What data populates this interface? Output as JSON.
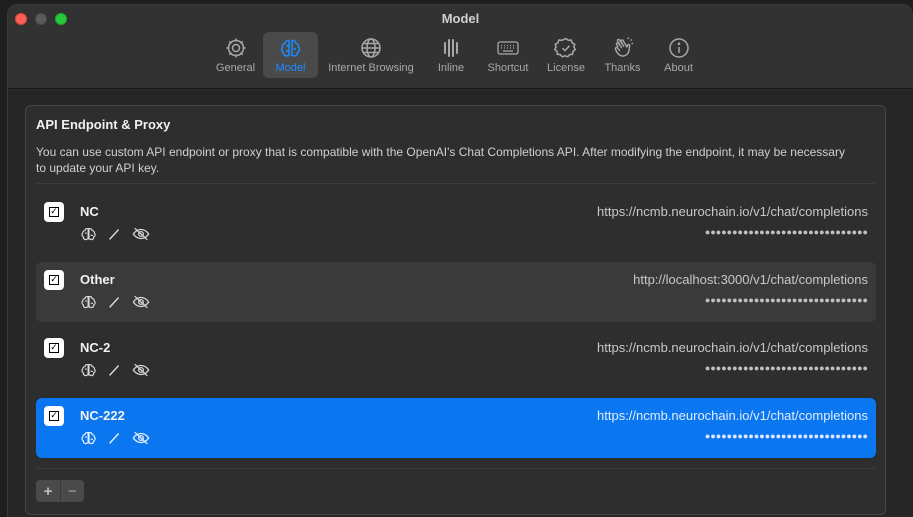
{
  "window": {
    "title": "Model"
  },
  "toolbar": {
    "items": [
      {
        "label": "General",
        "icon": "gear-icon",
        "active": false
      },
      {
        "label": "Model",
        "icon": "brain-icon",
        "active": true
      },
      {
        "label": "Internet Browsing",
        "icon": "globe-icon",
        "active": false
      },
      {
        "label": "Inline",
        "icon": "inline-bars-icon",
        "active": false
      },
      {
        "label": "Shortcut",
        "icon": "keyboard-icon",
        "active": false
      },
      {
        "label": "License",
        "icon": "badge-check-icon",
        "active": false
      },
      {
        "label": "Thanks",
        "icon": "clapping-hands-icon",
        "active": false
      },
      {
        "label": "About",
        "icon": "info-icon",
        "active": false
      }
    ]
  },
  "panel": {
    "title": "API Endpoint & Proxy",
    "description": "You can use custom API endpoint or proxy that is compatible with the OpenAI's Chat Completions API. After modifying the endpoint, it may be necessary to update your API key."
  },
  "endpoints": [
    {
      "name": "NC",
      "url": "https://ncmb.neurochain.io/v1/chat/completions",
      "key": "●●●●●●●●●●●●●●●●●●●●●●●●●●●●●●",
      "checked": true,
      "style": "plain"
    },
    {
      "name": "Other",
      "url": "http://localhost:3000/v1/chat/completions",
      "key": "●●●●●●●●●●●●●●●●●●●●●●●●●●●●●●",
      "checked": true,
      "style": "alt"
    },
    {
      "name": "NC-2",
      "url": "https://ncmb.neurochain.io/v1/chat/completions",
      "key": "●●●●●●●●●●●●●●●●●●●●●●●●●●●●●●",
      "checked": true,
      "style": "plain"
    },
    {
      "name": "NC-222",
      "url": "https://ncmb.neurochain.io/v1/chat/completions",
      "key": "●●●●●●●●●●●●●●●●●●●●●●●●●●●●●●",
      "checked": true,
      "style": "selected"
    }
  ],
  "controls": {
    "add_label": "+",
    "remove_label": "−"
  },
  "colors": {
    "accent": "#0a77f0",
    "active_tab": "#1a8cff"
  }
}
